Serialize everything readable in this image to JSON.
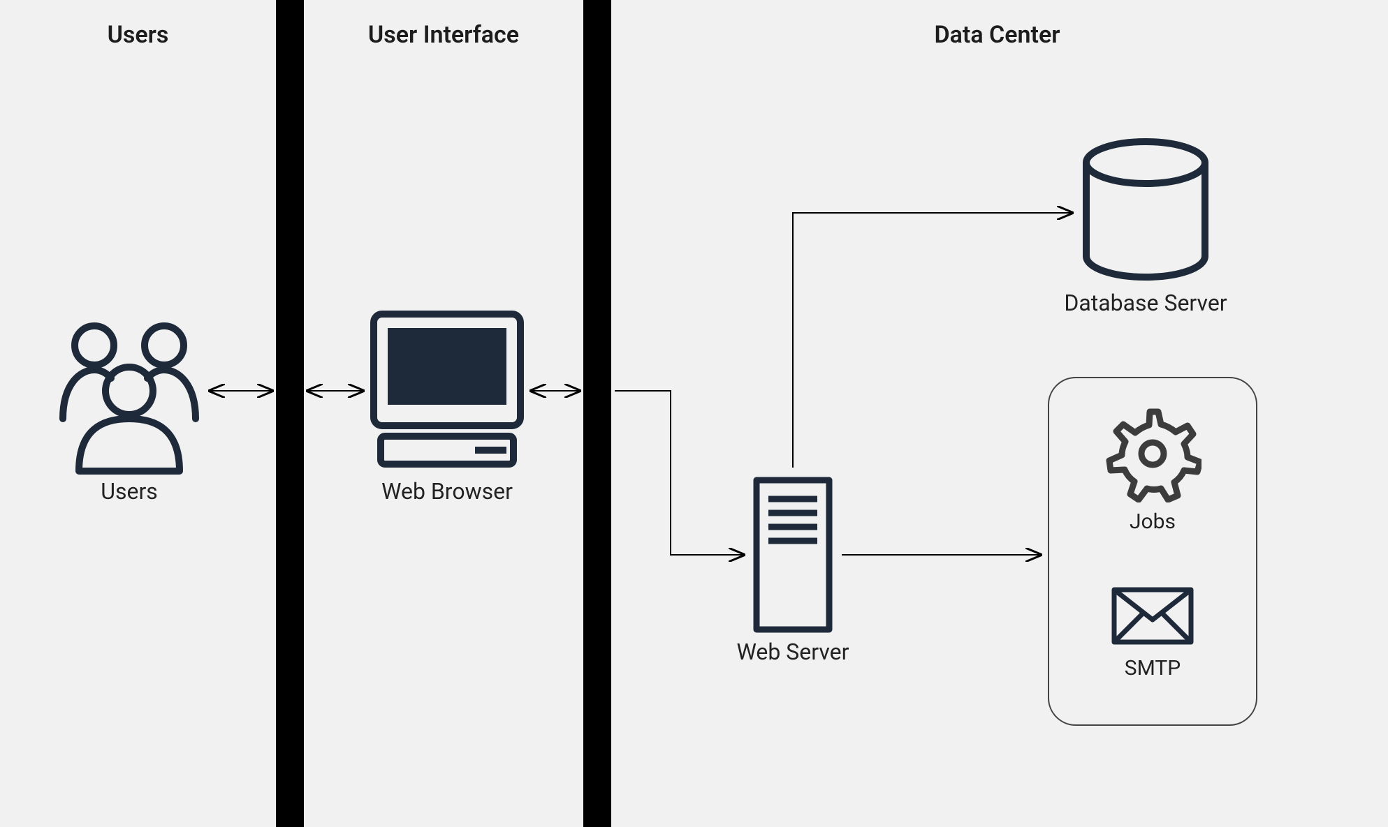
{
  "sections": {
    "users": "Users",
    "ui": "User Interface",
    "data_center": "Data Center"
  },
  "nodes": {
    "users": {
      "label": "Users"
    },
    "web_browser": {
      "label": "Web Browser"
    },
    "web_server": {
      "label": "Web Server"
    },
    "database_server": {
      "label": "Database Server"
    },
    "jobs": {
      "label": "Jobs"
    },
    "smtp": {
      "label": "SMTP"
    }
  },
  "connections": [
    {
      "from": "users",
      "to": "web_browser",
      "bidirectional": true
    },
    {
      "from": "web_browser",
      "to": "data_center_boundary",
      "bidirectional": true
    },
    {
      "from": "data_center_boundary",
      "to": "web_server",
      "bidirectional": false
    },
    {
      "from": "web_server",
      "to": "database_server",
      "bidirectional": false
    },
    {
      "from": "web_server",
      "to": "services_box",
      "bidirectional": false
    }
  ]
}
